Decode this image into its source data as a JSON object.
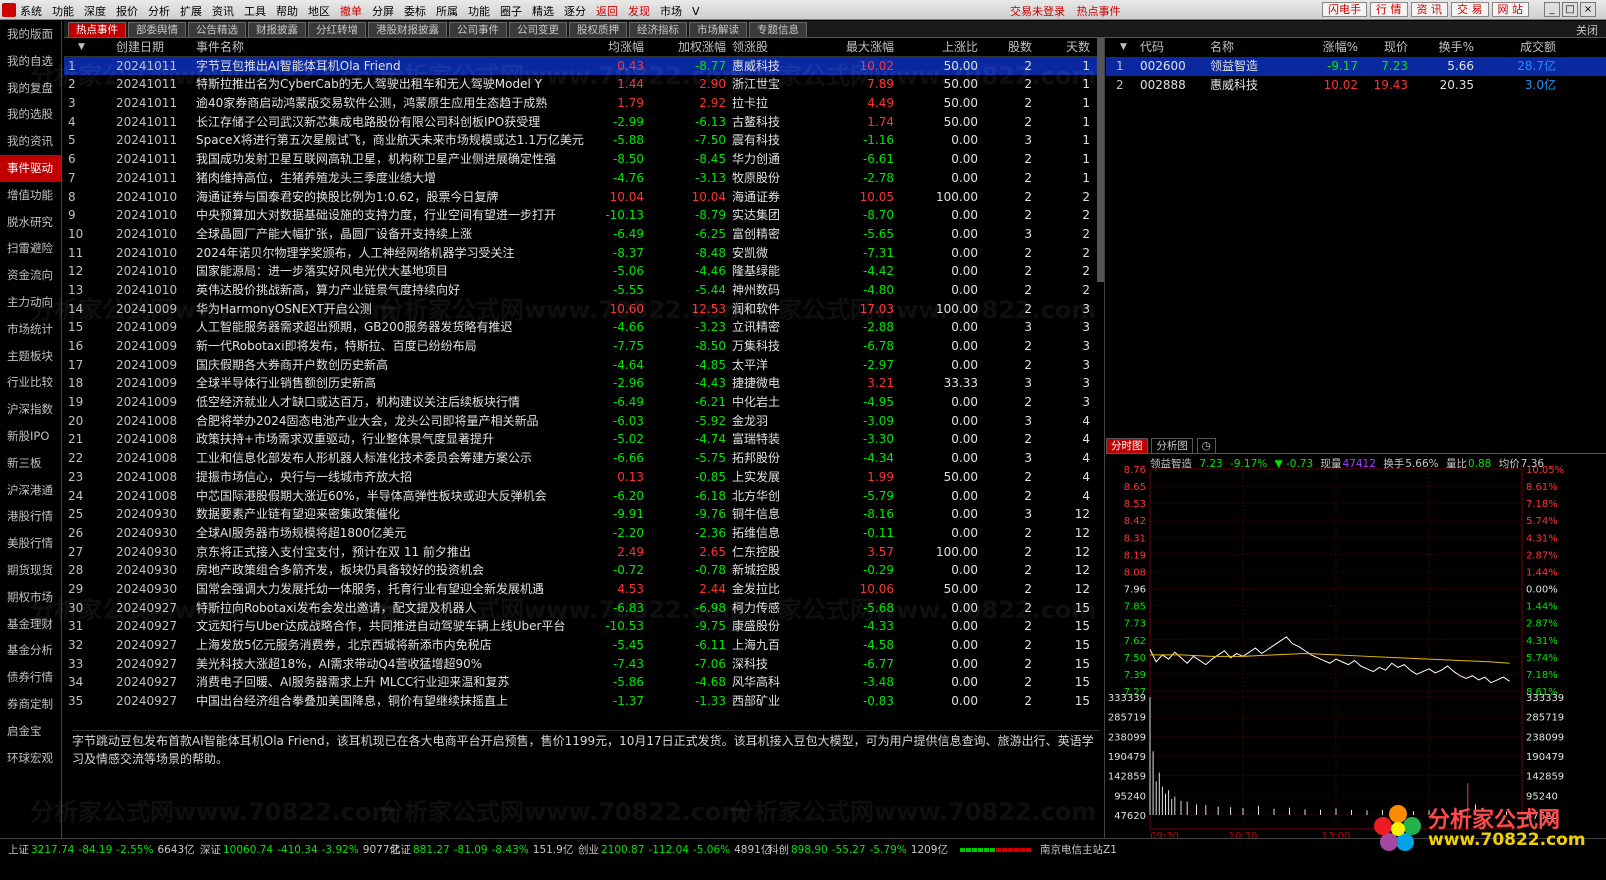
{
  "menu": {
    "items": [
      "系统",
      "功能",
      "深度",
      "报价",
      "分析",
      "扩展",
      "资讯",
      "工具",
      "帮助",
      "地区",
      "撤单",
      "分屏",
      "委标",
      "所属",
      "功能",
      "圈子",
      "精选",
      "逐分",
      "返回",
      "发现",
      "市场",
      "V"
    ],
    "status": [
      "交易未登录",
      "热点事件"
    ],
    "right_buttons": [
      "闪电手",
      "行 情",
      "资 讯",
      "交 易",
      "网 站"
    ]
  },
  "sidebar": {
    "items": [
      "我的版面",
      "我的自选",
      "我的复盘",
      "我的选股",
      "我的资讯",
      "事件驱动",
      "增值功能",
      "脱水研究",
      "扫雷避险",
      "资金流向",
      "主力动向",
      "市场统计",
      "主题板块",
      "行业比较",
      "沪深指数",
      "新股IPO",
      "新三板",
      "沪深港通",
      "港股行情",
      "美股行情",
      "期货现货",
      "期权市场",
      "基金理财",
      "基金分析",
      "债券行情",
      "券商定制",
      "启金宝",
      "环球宏观"
    ],
    "active_index": 5
  },
  "tabs": {
    "items": [
      "热点事件",
      "部委舆情",
      "公告精选",
      "财报披露",
      "分红转增",
      "港股财报披露",
      "公司事件",
      "公司变更",
      "股权质押",
      "经济指标",
      "市场解读",
      "专题信息"
    ],
    "active_index": 0,
    "close_label": "关闭"
  },
  "main_table": {
    "headers": {
      "date": "创建日期",
      "name": "事件名称",
      "avg": "均涨幅",
      "wavg": "加权涨幅",
      "lead": "领涨股",
      "max": "最大涨幅",
      "ratio": "上涨比",
      "cnt": "股数",
      "days": "天数"
    },
    "sort_icon": "▼",
    "selected_index": 0,
    "rows": [
      {
        "idx": "1",
        "date": "20241011",
        "name": "字节豆包推出AI智能体耳机Ola Friend",
        "avg": "0.43",
        "wavg": "-8.77",
        "lead": "惠威科技",
        "max": "10.02",
        "ratio": "50.00",
        "cnt": "2",
        "days": "1"
      },
      {
        "idx": "2",
        "date": "20241011",
        "name": "特斯拉推出名为CyberCab的无人驾驶出租车和无人驾驶Model Y",
        "avg": "1.44",
        "wavg": "2.90",
        "lead": "浙江世宝",
        "max": "7.89",
        "ratio": "50.00",
        "cnt": "2",
        "days": "1"
      },
      {
        "idx": "3",
        "date": "20241011",
        "name": "逾40家券商启动鸿蒙版交易软件公测，鸿蒙原生应用生态趋于成熟",
        "avg": "1.79",
        "wavg": "2.92",
        "lead": "拉卡拉",
        "max": "4.49",
        "ratio": "50.00",
        "cnt": "2",
        "days": "1"
      },
      {
        "idx": "4",
        "date": "20241011",
        "name": "长江存储子公司武汉新芯集成电路股份有限公司科创板IPO获受理",
        "avg": "-2.99",
        "wavg": "-6.13",
        "lead": "古鳌科技",
        "max": "1.74",
        "ratio": "50.00",
        "cnt": "2",
        "days": "1"
      },
      {
        "idx": "5",
        "date": "20241011",
        "name": "SpaceX将进行第五次星舰试飞，商业航天未来市场规模或达1.1万亿美元",
        "avg": "-5.88",
        "wavg": "-7.50",
        "lead": "震有科技",
        "max": "-1.16",
        "ratio": "0.00",
        "cnt": "3",
        "days": "1"
      },
      {
        "idx": "6",
        "date": "20241011",
        "name": "我国成功发射卫星互联网高轨卫星，机构称卫星产业侧进展确定性强",
        "avg": "-8.50",
        "wavg": "-8.45",
        "lead": "华力创通",
        "max": "-6.61",
        "ratio": "0.00",
        "cnt": "2",
        "days": "1"
      },
      {
        "idx": "7",
        "date": "20241011",
        "name": "猪肉维持高位，生猪养殖龙头三季度业绩大增",
        "avg": "-4.76",
        "wavg": "-3.13",
        "lead": "牧原股份",
        "max": "-2.78",
        "ratio": "0.00",
        "cnt": "2",
        "days": "1"
      },
      {
        "idx": "8",
        "date": "20241010",
        "name": "海通证券与国泰君安的换股比例为1:0.62，股票今日复牌",
        "avg": "10.04",
        "wavg": "10.04",
        "lead": "海通证券",
        "max": "10.05",
        "ratio": "100.00",
        "cnt": "2",
        "days": "2"
      },
      {
        "idx": "9",
        "date": "20241010",
        "name": "中央预算加大对数据基础设施的支持力度，行业空间有望进一步打开",
        "avg": "-10.13",
        "wavg": "-8.79",
        "lead": "实达集团",
        "max": "-8.70",
        "ratio": "0.00",
        "cnt": "2",
        "days": "2"
      },
      {
        "idx": "10",
        "date": "20241010",
        "name": "全球晶圆厂产能大幅扩张，晶圆厂设备开支持续上涨",
        "avg": "-6.49",
        "wavg": "-6.25",
        "lead": "富创精密",
        "max": "-5.65",
        "ratio": "0.00",
        "cnt": "3",
        "days": "2"
      },
      {
        "idx": "11",
        "date": "20241010",
        "name": "2024年诺贝尔物理学奖颁布，人工神经网络机器学习受关注",
        "avg": "-8.37",
        "wavg": "-8.48",
        "lead": "安凯微",
        "max": "-7.31",
        "ratio": "0.00",
        "cnt": "2",
        "days": "2"
      },
      {
        "idx": "12",
        "date": "20241010",
        "name": "国家能源局：进一步落实好风电光伏大基地项目",
        "avg": "-5.06",
        "wavg": "-4.46",
        "lead": "隆基绿能",
        "max": "-4.42",
        "ratio": "0.00",
        "cnt": "2",
        "days": "2"
      },
      {
        "idx": "13",
        "date": "20241010",
        "name": "英伟达股价挑战新高，算力产业链景气度持续向好",
        "avg": "-5.55",
        "wavg": "-5.44",
        "lead": "神州数码",
        "max": "-4.80",
        "ratio": "0.00",
        "cnt": "2",
        "days": "2"
      },
      {
        "idx": "14",
        "date": "20241009",
        "name": "华为HarmonyOSNEXT开启公测",
        "avg": "10.60",
        "wavg": "12.53",
        "lead": "润和软件",
        "max": "17.03",
        "ratio": "100.00",
        "cnt": "2",
        "days": "3"
      },
      {
        "idx": "15",
        "date": "20241009",
        "name": "人工智能服务器需求超出预期，GB200服务器发货略有推迟",
        "avg": "-4.66",
        "wavg": "-3.23",
        "lead": "立讯精密",
        "max": "-2.88",
        "ratio": "0.00",
        "cnt": "3",
        "days": "3"
      },
      {
        "idx": "16",
        "date": "20241009",
        "name": "新一代Robotaxi即将发布，特斯拉、百度已纷纷布局",
        "avg": "-7.75",
        "wavg": "-8.50",
        "lead": "万集科技",
        "max": "-6.78",
        "ratio": "0.00",
        "cnt": "2",
        "days": "3"
      },
      {
        "idx": "17",
        "date": "20241009",
        "name": "国庆假期各大券商开户数创历史新高",
        "avg": "-4.64",
        "wavg": "-4.85",
        "lead": "太平洋",
        "max": "-2.97",
        "ratio": "0.00",
        "cnt": "2",
        "days": "3"
      },
      {
        "idx": "18",
        "date": "20241009",
        "name": "全球半导体行业销售额创历史新高",
        "avg": "-2.96",
        "wavg": "-4.43",
        "lead": "捷捷微电",
        "max": "3.21",
        "ratio": "33.33",
        "cnt": "3",
        "days": "3"
      },
      {
        "idx": "19",
        "date": "20241009",
        "name": "低空经济就业人才缺口或达百万，机构建议关注后续板块行情",
        "avg": "-6.49",
        "wavg": "-6.21",
        "lead": "中化岩土",
        "max": "-4.95",
        "ratio": "0.00",
        "cnt": "2",
        "days": "3"
      },
      {
        "idx": "20",
        "date": "20241008",
        "name": "合肥将举办2024固态电池产业大会，龙头公司即将量产相关新品",
        "avg": "-6.03",
        "wavg": "-5.92",
        "lead": "金龙羽",
        "max": "-3.09",
        "ratio": "0.00",
        "cnt": "3",
        "days": "4"
      },
      {
        "idx": "21",
        "date": "20241008",
        "name": "政策扶持+市场需求双重驱动，行业整体景气度显著提升",
        "avg": "-5.02",
        "wavg": "-4.74",
        "lead": "富瑞特装",
        "max": "-3.30",
        "ratio": "0.00",
        "cnt": "2",
        "days": "4"
      },
      {
        "idx": "22",
        "date": "20241008",
        "name": "工业和信息化部发布人形机器人标准化技术委员会筹建方案公示",
        "avg": "-6.66",
        "wavg": "-5.75",
        "lead": "拓邦股份",
        "max": "-4.34",
        "ratio": "0.00",
        "cnt": "3",
        "days": "4"
      },
      {
        "idx": "23",
        "date": "20241008",
        "name": "提振市场信心，央行与一线城市齐放大招",
        "avg": "0.13",
        "wavg": "-0.85",
        "lead": "上实发展",
        "max": "1.99",
        "ratio": "50.00",
        "cnt": "2",
        "days": "4"
      },
      {
        "idx": "24",
        "date": "20241008",
        "name": "中芯国际港股假期大涨近60%，半导体高弹性板块或迎大反弹机会",
        "avg": "-6.20",
        "wavg": "-6.18",
        "lead": "北方华创",
        "max": "-5.79",
        "ratio": "0.00",
        "cnt": "2",
        "days": "4"
      },
      {
        "idx": "25",
        "date": "20240930",
        "name": "数据要素产业链有望迎来密集政策催化",
        "avg": "-9.91",
        "wavg": "-9.76",
        "lead": "铜牛信息",
        "max": "-8.16",
        "ratio": "0.00",
        "cnt": "3",
        "days": "12"
      },
      {
        "idx": "26",
        "date": "20240930",
        "name": "全球AI服务器市场规模将超1800亿美元",
        "avg": "-2.20",
        "wavg": "-2.36",
        "lead": "拓维信息",
        "max": "-0.11",
        "ratio": "0.00",
        "cnt": "2",
        "days": "12"
      },
      {
        "idx": "27",
        "date": "20240930",
        "name": "京东将正式接入支付宝支付，预计在双 11 前夕推出",
        "avg": "2.49",
        "wavg": "2.65",
        "lead": "仁东控股",
        "max": "3.57",
        "ratio": "100.00",
        "cnt": "2",
        "days": "12"
      },
      {
        "idx": "28",
        "date": "20240930",
        "name": "房地产政策组合多箭齐发，板块仍具备较好的投资机会",
        "avg": "-0.72",
        "wavg": "-0.78",
        "lead": "新城控股",
        "max": "-0.29",
        "ratio": "0.00",
        "cnt": "2",
        "days": "12"
      },
      {
        "idx": "29",
        "date": "20240930",
        "name": "国常会强调大力发展托幼一体服务，托育行业有望迎全新发展机遇",
        "avg": "4.53",
        "wavg": "2.44",
        "lead": "金发拉比",
        "max": "10.06",
        "ratio": "50.00",
        "cnt": "2",
        "days": "12"
      },
      {
        "idx": "30",
        "date": "20240927",
        "name": "特斯拉向Robotaxi发布会发出邀请，配文提及机器人",
        "avg": "-6.83",
        "wavg": "-6.98",
        "lead": "柯力传感",
        "max": "-5.68",
        "ratio": "0.00",
        "cnt": "2",
        "days": "15"
      },
      {
        "idx": "31",
        "date": "20240927",
        "name": "文远知行与Uber达成战略合作，共同推进自动驾驶车辆上线Uber平台",
        "avg": "-10.53",
        "wavg": "-9.75",
        "lead": "康盛股份",
        "max": "-4.33",
        "ratio": "0.00",
        "cnt": "2",
        "days": "15"
      },
      {
        "idx": "32",
        "date": "20240927",
        "name": "上海发放5亿元服务消费券，北京西城将新添市内免税店",
        "avg": "-5.45",
        "wavg": "-6.11",
        "lead": "上海九百",
        "max": "-4.58",
        "ratio": "0.00",
        "cnt": "2",
        "days": "15"
      },
      {
        "idx": "33",
        "date": "20240927",
        "name": "美光科技大涨超18%，AI需求带动Q4营收猛增超90%",
        "avg": "-7.43",
        "wavg": "-7.06",
        "lead": "深科技",
        "max": "-6.77",
        "ratio": "0.00",
        "cnt": "2",
        "days": "15"
      },
      {
        "idx": "34",
        "date": "20240927",
        "name": "消费电子回暖、AI服务器需求上升 MLCC行业迎来温和复苏",
        "avg": "-5.86",
        "wavg": "-4.68",
        "lead": "风华高科",
        "max": "-3.48",
        "ratio": "0.00",
        "cnt": "2",
        "days": "15"
      },
      {
        "idx": "35",
        "date": "20240927",
        "name": "中国出台经济组合拳叠加美国降息，铜价有望继续抹摇直上",
        "avg": "-1.37",
        "wavg": "-1.33",
        "lead": "西部矿业",
        "max": "-0.83",
        "ratio": "0.00",
        "cnt": "2",
        "days": "15"
      }
    ]
  },
  "description": "字节跳动豆包发布首款AI智能体耳机Ola Friend，该耳机现已在各大电商平台开启预售，售价1199元，10月17日正式发货。该耳机接入豆包大模型，可为用户提供信息查询、旅游出行、英语学习及情感交流等场景的帮助。",
  "stock_table": {
    "headers": {
      "code": "代码",
      "name": "名称",
      "chg": "涨幅%",
      "price": "现价",
      "turn": "换手%",
      "vol": "成交额"
    },
    "rows": [
      {
        "idx": "1",
        "code": "002600",
        "name": "领益智造",
        "chg": "-9.17",
        "price": "7.23",
        "turn": "5.66",
        "vol": "28.7亿"
      },
      {
        "idx": "2",
        "code": "002888",
        "name": "惠威科技",
        "chg": "10.02",
        "price": "19.43",
        "turn": "20.35",
        "vol": "3.0亿"
      }
    ]
  },
  "chart_tabs": [
    "分时图",
    "分析图"
  ],
  "chart_info": {
    "stock": "领益智造",
    "price": "7.23",
    "pct": "-9.17%",
    "change": "▼ -0.73",
    "vol_label": "现量",
    "vol": "47412",
    "turn_label": "换手",
    "turn": "5.66%",
    "ratio_label": "量比",
    "ratio": "0.88",
    "avg_label": "均价",
    "avg": "7.36"
  },
  "chart_data": {
    "type": "line",
    "title": "",
    "xlabel": "",
    "ylabel": "",
    "price_ticks": [
      "8.76",
      "8.65",
      "8.53",
      "8.42",
      "8.31",
      "8.19",
      "8.08",
      "7.96",
      "7.85",
      "7.73",
      "7.62",
      "7.50",
      "7.39",
      "7.27"
    ],
    "pct_ticks": [
      "10.05%",
      "8.61%",
      "7.18%",
      "5.74%",
      "4.31%",
      "2.87%",
      "1.44%",
      "0.00%",
      "1.44%",
      "2.87%",
      "4.31%",
      "5.74%",
      "7.18%",
      "8.61%"
    ],
    "volume_ticks": [
      "333339",
      "285719",
      "238099",
      "190479",
      "142859",
      "95240",
      "47620"
    ],
    "time_ticks": [
      "09:30",
      "10:30",
      "13:00"
    ],
    "ylim": [
      7.16,
      8.76
    ],
    "prev_close": 7.96,
    "price_series": {
      "name": "",
      "x": [
        0,
        4,
        8,
        12,
        16,
        20,
        24,
        28,
        32,
        36,
        40,
        44,
        48,
        52,
        56,
        60,
        64,
        68,
        72,
        76,
        80,
        84,
        88,
        92,
        96,
        100,
        104,
        108,
        112,
        116,
        120,
        124,
        128,
        132,
        136,
        140,
        144,
        148,
        152,
        156,
        160,
        164,
        168,
        172,
        176,
        180,
        184,
        188,
        192,
        196,
        200,
        204,
        208,
        212,
        216,
        220,
        224,
        228,
        232
      ],
      "values": [
        7.46,
        7.37,
        7.42,
        7.39,
        7.44,
        7.4,
        7.36,
        7.41,
        7.38,
        7.35,
        7.39,
        7.42,
        7.45,
        7.4,
        7.43,
        7.41,
        7.44,
        7.47,
        7.43,
        7.46,
        7.49,
        7.52,
        7.55,
        7.5,
        7.48,
        7.45,
        7.42,
        7.4,
        7.38,
        7.36,
        7.39,
        7.37,
        7.35,
        7.38,
        7.34,
        7.32,
        7.3,
        7.33,
        7.31,
        7.36,
        7.33,
        7.35,
        7.31,
        7.28,
        7.3,
        7.32,
        7.29,
        7.31,
        7.34,
        7.3,
        7.27,
        7.25,
        7.27,
        7.24,
        7.26,
        7.22,
        7.24,
        7.26,
        7.23
      ]
    },
    "avg_series": {
      "name": "",
      "x": [
        0,
        20,
        40,
        60,
        80,
        100,
        120,
        140,
        160,
        180,
        200,
        220,
        232
      ],
      "values": [
        7.42,
        7.42,
        7.41,
        7.41,
        7.42,
        7.43,
        7.42,
        7.41,
        7.4,
        7.39,
        7.38,
        7.37,
        7.36
      ]
    },
    "volume": {
      "x": [
        0,
        2,
        4,
        6,
        8,
        10,
        12,
        14,
        16,
        20,
        24,
        30,
        36,
        44,
        52,
        60,
        70,
        80,
        90,
        100,
        110,
        120,
        130,
        140,
        150,
        160,
        170,
        180,
        190,
        200,
        205,
        210,
        220,
        230
      ],
      "values": [
        333339,
        180000,
        95000,
        120000,
        80000,
        60000,
        70000,
        45000,
        52000,
        40000,
        38000,
        30000,
        28000,
        24000,
        22000,
        20000,
        26000,
        18000,
        21000,
        16000,
        15000,
        19000,
        14000,
        13000,
        15000,
        12000,
        11000,
        13000,
        12000,
        14000,
        90000,
        30000,
        12000,
        10000
      ]
    }
  },
  "statusbar": {
    "indices": [
      {
        "name": "上证",
        "value": "3217.74",
        "chg": "-84.19",
        "pct": "-2.55%",
        "amt": "6643亿"
      },
      {
        "name": "深证",
        "value": "10060.74",
        "chg": "-410.34",
        "pct": "-3.92%",
        "amt": "9077亿"
      },
      {
        "name": "北证",
        "value": "881.27",
        "chg": "-81.09",
        "pct": "-8.43%",
        "amt": "151.9亿"
      },
      {
        "name": "创业",
        "value": "2100.87",
        "chg": "-112.04",
        "pct": "-5.06%",
        "amt": "4891亿"
      },
      {
        "name": "科创",
        "value": "898.90",
        "chg": "-55.27",
        "pct": "-5.79%",
        "amt": "1209亿"
      }
    ],
    "server": "南京电信主站Z1"
  },
  "watermark": {
    "logo_title": "分析家公式网",
    "logo_url": "www.70822.com",
    "text": "分析家公式网www.70822.com"
  },
  "colors": {
    "up": "#ff3232",
    "down": "#00e600",
    "accent": "#c00000",
    "select": "#0a28a0"
  }
}
